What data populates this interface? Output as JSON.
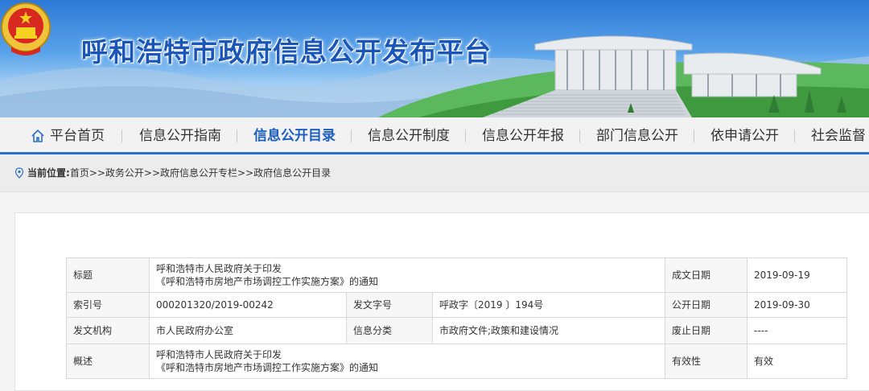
{
  "header": {
    "site_title": "呼和浩特市政府信息公开发布平台",
    "emblem": "national-emblem"
  },
  "nav": {
    "items": [
      {
        "label": "平台首页",
        "icon": "home-icon"
      },
      {
        "label": "信息公开指南"
      },
      {
        "label": "信息公开目录",
        "active": true
      },
      {
        "label": "信息公开制度"
      },
      {
        "label": "信息公开年报"
      },
      {
        "label": "部门信息公开"
      },
      {
        "label": "依申请公开"
      },
      {
        "label": "社会监督"
      }
    ]
  },
  "breadcrumb": {
    "prefix": "当前位置:",
    "path": "首页>>政务公开>>政府信息公开专栏>>政府信息公开目录"
  },
  "info_table": {
    "title_label": "标题",
    "title_line1": "呼和浩特市人民政府关于印发",
    "title_line2": "《呼和浩特市房地产市场调控工作实施方案》的通知",
    "date_label": "成文日期",
    "date_value": "2019-09-19",
    "index_label": "索引号",
    "index_value": "000201320/2019-00242",
    "docno_label": "发文字号",
    "docno_value": "呼政字〔2019 〕194号",
    "pubdate_label": "公开日期",
    "pubdate_value": "2019-09-30",
    "issuer_label": "发文机构",
    "issuer_value": "市人民政府办公室",
    "category_label": "信息分类",
    "category_value": "市政府文件;政策和建设情况",
    "expire_label": "废止日期",
    "expire_value": "----",
    "summary_label": "概述",
    "summary_line1": "呼和浩特市人民政府关于印发",
    "summary_line2": "《呼和浩特市房地产市场调控工作实施方案》的通知",
    "validity_label": "有效性",
    "validity_value": "有效"
  }
}
